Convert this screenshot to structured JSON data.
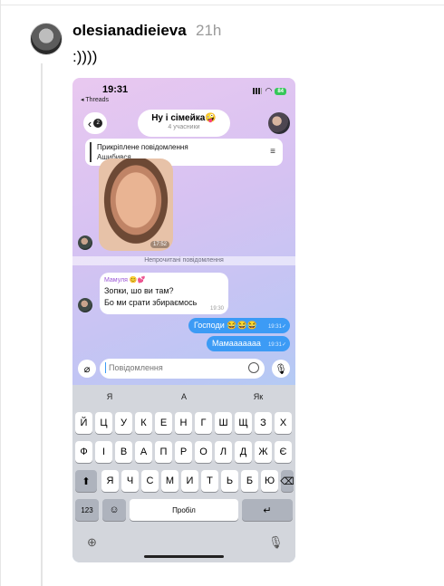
{
  "post": {
    "username": "olesianadieieva",
    "time": "21h",
    "text": ":))))"
  },
  "phone": {
    "status": {
      "time": "19:31",
      "back_app": "◂ Threads",
      "battery": "84"
    },
    "header": {
      "title": "Ну і сімейка🤪",
      "subtitle": "4 учасники",
      "back_count": "2"
    },
    "pinned": {
      "title": "Прикріплене повідомлення",
      "text": "Ашибився"
    },
    "sticker_time": "17:52",
    "unread_label": "Непрочитані повідомлення",
    "incoming": {
      "sender": "Мамуля 😊💕",
      "lines": [
        "Зопки, шо ви там?",
        "Бо ми срати збираємось"
      ],
      "time": "19:30"
    },
    "outgoing": [
      {
        "text": "Господи 😂😂😂",
        "time": "19:31✓"
      },
      {
        "text": "Мамааааааа",
        "time": "19:31✓"
      }
    ],
    "input": {
      "placeholder": "Повідомлення"
    },
    "keyboard": {
      "suggestions": [
        "Я",
        "А",
        "Як"
      ],
      "row1": [
        "Й",
        "Ц",
        "У",
        "К",
        "Е",
        "Н",
        "Г",
        "Ш",
        "Щ",
        "З",
        "Х"
      ],
      "row2": [
        "Ф",
        "І",
        "В",
        "А",
        "П",
        "Р",
        "О",
        "Л",
        "Д",
        "Ж",
        "Є"
      ],
      "row3": [
        "Я",
        "Ч",
        "С",
        "М",
        "И",
        "Т",
        "Ь",
        "Б",
        "Ю"
      ],
      "numbers_key": "123",
      "space_key": "Пробіл"
    }
  }
}
